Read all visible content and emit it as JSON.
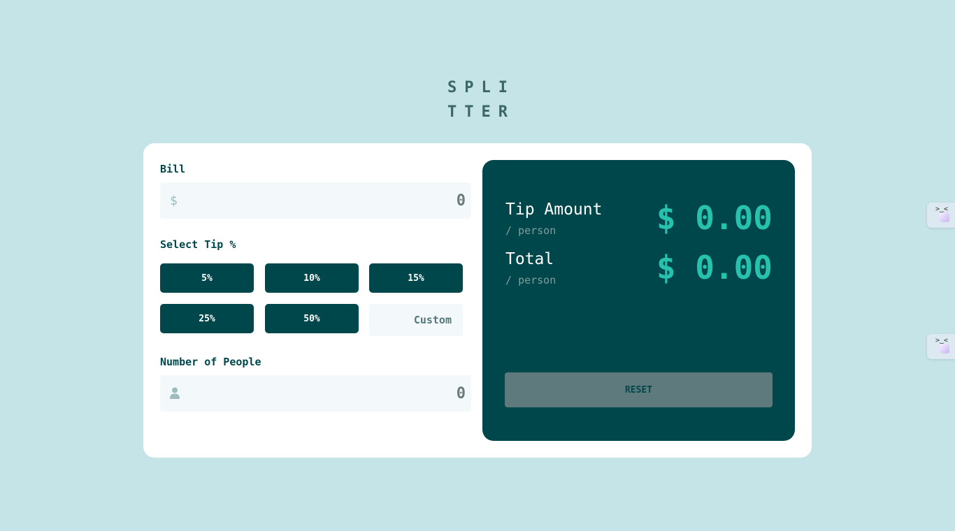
{
  "app": {
    "logo": "SPLITTER"
  },
  "bill": {
    "label": "Bill",
    "currency_symbol": "$",
    "placeholder": "0"
  },
  "tip": {
    "label": "Select Tip %",
    "options": [
      "5%",
      "10%",
      "15%",
      "25%",
      "50%"
    ],
    "custom_placeholder": "Custom"
  },
  "people": {
    "label": "Number of People",
    "placeholder": "0"
  },
  "results": {
    "tip_label": "Tip Amount",
    "tip_sub": "/ person",
    "tip_value": "$ 0.00",
    "total_label": "Total",
    "total_sub": "/ person",
    "total_value": "$ 0.00",
    "reset_label": "RESET"
  },
  "colors": {
    "background": "#c5e4e7",
    "panel": "#00474b",
    "accent": "#26c2ad",
    "reset_disabled": "#5e7a7d"
  }
}
